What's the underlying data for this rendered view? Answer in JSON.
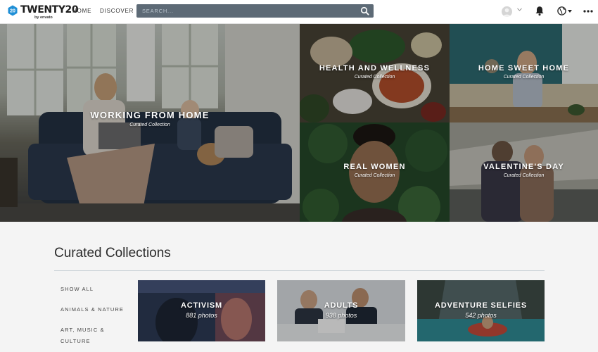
{
  "brand": {
    "logo_badge": "20",
    "name": "TWENTY20",
    "byline": "by envato"
  },
  "nav": {
    "home_label": "HOME",
    "discover_label": "DISCOVER"
  },
  "search": {
    "placeholder": "SEARCH..."
  },
  "icons": {
    "search": "search-icon",
    "avatar": "user-avatar",
    "chevron": "chevron-down-icon",
    "bell": "bell-icon",
    "globe": "globe-icon",
    "more": "more-dots-icon"
  },
  "hero": {
    "tiles": [
      {
        "title": "WORKING FROM HOME",
        "subtitle": "Curated Collection"
      },
      {
        "title": "HEALTH AND WELLNESS",
        "subtitle": "Curated Collection"
      },
      {
        "title": "HOME SWEET HOME",
        "subtitle": "Curated Collection"
      },
      {
        "title": "REAL WOMEN",
        "subtitle": "Curated Collection"
      },
      {
        "title": "VALENTINE'S DAY",
        "subtitle": "Curated Collection"
      }
    ]
  },
  "collections": {
    "title": "Curated Collections",
    "categories": [
      "SHOW ALL",
      "ANIMALS & NATURE",
      "ART, MUSIC & CULTURE"
    ],
    "cards": [
      {
        "title": "ACTIVISM",
        "count": "881 photos"
      },
      {
        "title": "ADULTS",
        "count": "938 photos"
      },
      {
        "title": "ADVENTURE SELFIES",
        "count": "542 photos"
      }
    ]
  },
  "colors": {
    "search_bg": "#5d6a76",
    "topbar_bg": "#ffffff",
    "page_bg": "#f4f4f4",
    "logo_blue": "#1f8fd6"
  }
}
